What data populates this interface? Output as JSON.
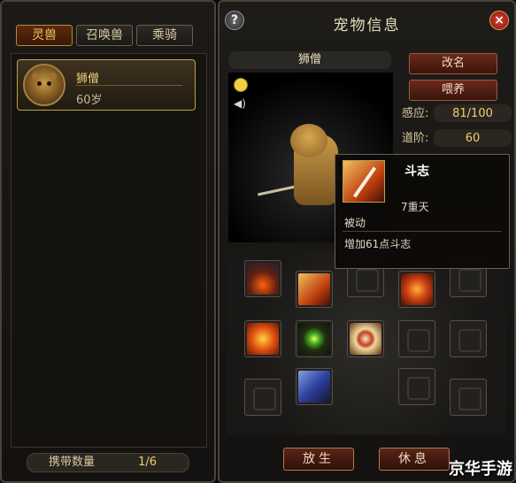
{
  "left": {
    "tabs": [
      {
        "label": "灵兽",
        "active": true
      },
      {
        "label": "召唤兽",
        "active": false
      },
      {
        "label": "乘骑",
        "active": false
      }
    ],
    "pets": [
      {
        "name": "狮僧",
        "age": "60岁"
      }
    ],
    "carry": {
      "label": "携带数量",
      "value": "1/6"
    }
  },
  "right": {
    "title": "宠物信息",
    "pet_name": "狮僧",
    "buttons": {
      "rename": "改名",
      "feed": "喂养",
      "release": "放生",
      "rest": "休息"
    },
    "stats": [
      {
        "label": "感应:",
        "value": "81/100"
      },
      {
        "label": "道阶:",
        "value": "60"
      }
    ],
    "tooltip": {
      "title": "斗志",
      "level": "7重天",
      "type": "被动",
      "desc": "增加61点斗志"
    },
    "skills": [
      {
        "name": "hammer-strike-skill-icon"
      },
      {
        "name": "spear-thrust-skill-icon"
      },
      {
        "name": "fire-swirl-skill-icon"
      },
      {
        "name": "flame-fist-skill-icon"
      },
      {
        "name": "beast-eye-skill-icon"
      },
      {
        "name": "target-strike-skill-icon"
      },
      {
        "name": "shield-slash-skill-icon"
      }
    ]
  },
  "watermark": "京华手游"
}
